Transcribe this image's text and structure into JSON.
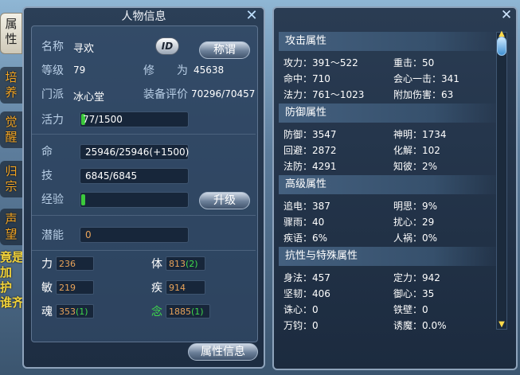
{
  "left_tabs": [
    {
      "label": "属\n性",
      "active": true
    },
    {
      "label": "培\n养"
    },
    {
      "label": "觉\n醒"
    },
    {
      "label": "归\n宗"
    },
    {
      "label": "声\n望"
    }
  ],
  "side_text": "竟是\n加\n护\n谁齐",
  "char_panel": {
    "title": "人物信息",
    "name_label": "名称",
    "name_value": "寻欢",
    "id_button": "ID",
    "title_button": "称谓",
    "level_label": "等级",
    "level_value": "79",
    "cultivation_label": "修　　为",
    "cultivation_value": "45638",
    "sect_label": "门派",
    "sect_value": "冰心堂",
    "equip_label": "装备评价",
    "equip_value": "70296/70457",
    "vitality_label": "活力",
    "vitality_value": "77/1500",
    "life_label": "命",
    "life_value": "25946/25946(+1500)",
    "skill_label": "技",
    "skill_value": "6845/6845",
    "exp_label": "经验",
    "upgrade_button": "升级",
    "potential_label": "潜能",
    "potential_value": "0",
    "attrs": {
      "str_label": "力",
      "str_value": "236",
      "con_label": "体",
      "con_value": "813",
      "con_bonus": "(2)",
      "agi_label": "敏",
      "agi_value": "219",
      "spd_label": "疾",
      "spd_value": "914",
      "soul_label": "魂",
      "soul_value": "353",
      "soul_bonus": "(1)",
      "mind_label": "念",
      "mind_value": "1885",
      "mind_bonus": "(1)"
    },
    "attr_info_button": "属性信息",
    "colors": {
      "accent_green": "#3fd94b",
      "value_orange": "#e8a35a"
    }
  },
  "stats_panel": {
    "attack_header": "攻击属性",
    "attack": [
      [
        "攻力：391～522",
        "重击：50"
      ],
      [
        "命中：710",
        "会心一击：341"
      ],
      [
        "法力：761～1023",
        "附加伤害：63"
      ]
    ],
    "defense_header": "防御属性",
    "defense": [
      [
        "防御：3547",
        "神明：1734"
      ],
      [
        "回避：2872",
        "化解：102"
      ],
      [
        "法防：4291",
        "知彼：2%"
      ]
    ],
    "advanced_header": "高级属性",
    "advanced": [
      [
        "追电：387",
        "明思：9%"
      ],
      [
        "骤雨：40",
        "扰心：29"
      ],
      [
        "疾语：6%",
        "人祸：0%"
      ]
    ],
    "resist_header": "抗性与特殊属性",
    "resist": [
      [
        "身法：457",
        "定力：942"
      ],
      [
        "坚韧：406",
        "御心：35"
      ],
      [
        "诛心：0",
        "铁壁：0"
      ],
      [
        "万钧：0",
        "诱魔：0.0%"
      ]
    ]
  }
}
